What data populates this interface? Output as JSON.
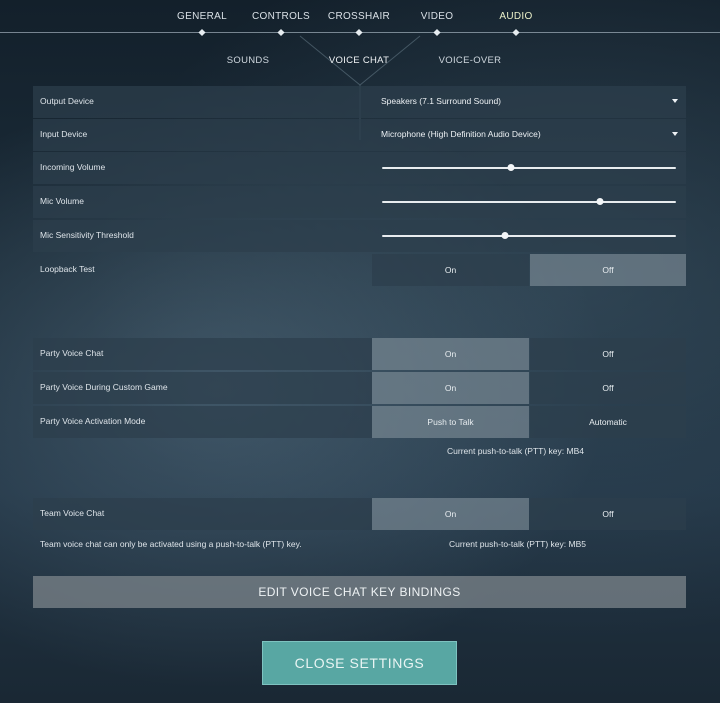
{
  "colors": {
    "accent_teal": "#58a7a3",
    "active_tab": "#eaf0c8",
    "panel": "#2d3e4c",
    "selected_toggle": "#7d8c96"
  },
  "nav": {
    "tabs": [
      {
        "label": "GENERAL"
      },
      {
        "label": "CONTROLS"
      },
      {
        "label": "CROSSHAIR"
      },
      {
        "label": "VIDEO"
      },
      {
        "label": "AUDIO",
        "active": true
      }
    ],
    "subtabs": [
      {
        "label": "SOUNDS"
      },
      {
        "label": "VOICE CHAT",
        "active": true
      },
      {
        "label": "VOICE-OVER"
      }
    ]
  },
  "settings": {
    "output_device": {
      "label": "Output Device",
      "value": "Speakers (7.1 Surround Sound)"
    },
    "input_device": {
      "label": "Input Device",
      "value": "Microphone (High Definition Audio Device)"
    },
    "incoming_volume": {
      "label": "Incoming Volume",
      "level": 0.44
    },
    "mic_volume": {
      "label": "Mic Volume",
      "level": 0.74
    },
    "mic_sensitivity": {
      "label": "Mic Sensitivity Threshold",
      "level": 0.42
    },
    "loopback_test": {
      "label": "Loopback Test",
      "on": "On",
      "off": "Off",
      "selected": "off"
    },
    "party_voice_chat": {
      "label": "Party Voice Chat",
      "on": "On",
      "off": "Off",
      "selected": "on"
    },
    "party_voice_custom": {
      "label": "Party Voice During Custom Game",
      "on": "On",
      "off": "Off",
      "selected": "on"
    },
    "party_activation": {
      "label": "Party Voice Activation Mode",
      "opt1": "Push to Talk",
      "opt2": "Automatic",
      "selected": "opt1"
    },
    "party_ptt_note": "Current push-to-talk (PTT) key: MB4",
    "team_voice_chat": {
      "label": "Team Voice Chat",
      "on": "On",
      "off": "Off",
      "selected": "on"
    },
    "team_note": "Team voice chat can only be activated using a push-to-talk (PTT) key.",
    "team_ptt_note": "Current push-to-talk (PTT) key: MB5"
  },
  "buttons": {
    "edit_keybindings": "EDIT VOICE CHAT KEY BINDINGS",
    "close_settings": "CLOSE SETTINGS"
  },
  "icons": {
    "dropdown": "caret-down-icon",
    "tab_marker": "diamond-icon"
  }
}
